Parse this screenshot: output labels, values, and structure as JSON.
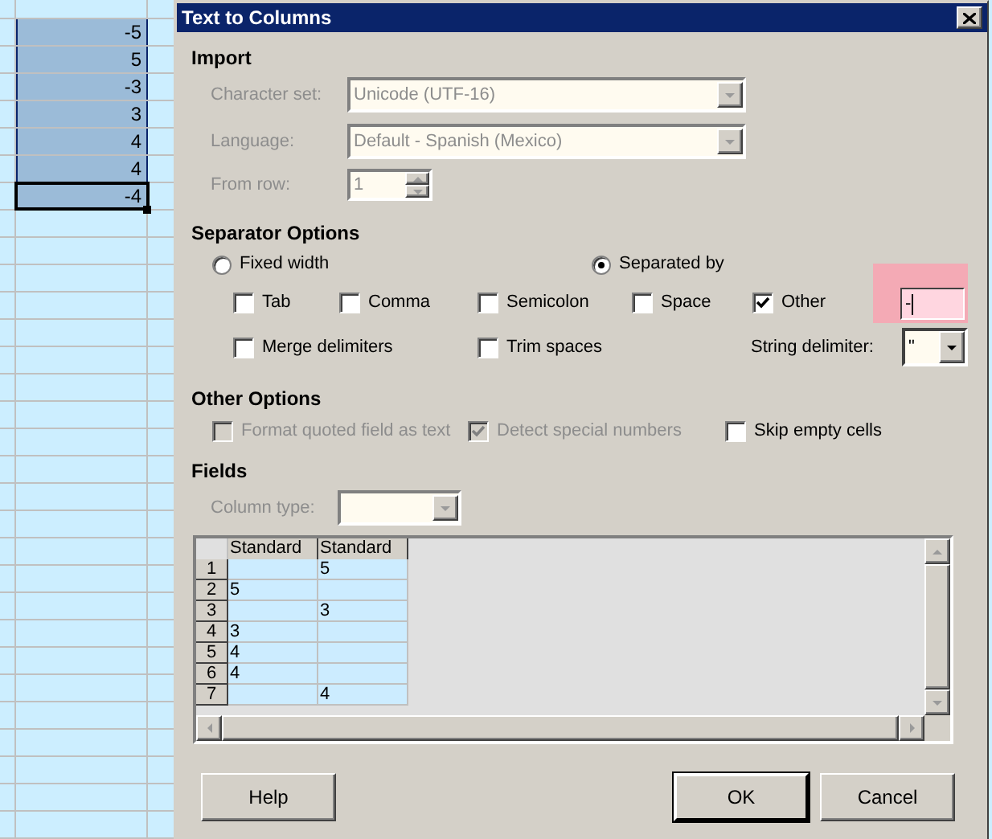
{
  "spreadsheet": {
    "cells": [
      {
        "value": "-5",
        "selected": true,
        "active": false
      },
      {
        "value": "5",
        "selected": true,
        "active": false
      },
      {
        "value": "-3",
        "selected": true,
        "active": false
      },
      {
        "value": "3",
        "selected": true,
        "active": false
      },
      {
        "value": "4",
        "selected": true,
        "active": false
      },
      {
        "value": "4",
        "selected": true,
        "active": false
      },
      {
        "value": "-4",
        "selected": true,
        "active": true
      }
    ]
  },
  "dialog": {
    "title": "Text to Columns",
    "import": {
      "heading": "Import",
      "fields": [
        {
          "label": "Character set:",
          "value": "Unicode (UTF-16)",
          "kind": "combo",
          "disabled": true
        },
        {
          "label": "Language:",
          "value": "Default - Spanish (Mexico)",
          "kind": "combo",
          "disabled": true
        },
        {
          "label": "From row:",
          "value": "1",
          "kind": "spin",
          "disabled": true
        }
      ]
    },
    "separator_options": {
      "heading": "Separator Options",
      "modes": [
        {
          "label": "Fixed width",
          "selected": false
        },
        {
          "label": "Separated by",
          "selected": true
        }
      ],
      "separators": [
        {
          "label": "Tab",
          "checked": false
        },
        {
          "label": "Comma",
          "checked": false
        },
        {
          "label": "Semicolon",
          "checked": false
        },
        {
          "label": "Space",
          "checked": false
        },
        {
          "label": "Other",
          "checked": true
        }
      ],
      "other_field": {
        "value": "-",
        "highlighted": true
      },
      "merge_delimiters": {
        "label": "Merge delimiters",
        "checked": false
      },
      "trim_spaces": {
        "label": "Trim spaces",
        "checked": false
      },
      "string_delimiter": {
        "label": "String delimiter:",
        "value": "\""
      }
    },
    "other_options": {
      "heading": "Other Options",
      "options": [
        {
          "label": "Format quoted field as text",
          "checked": false,
          "disabled": true
        },
        {
          "label": "Detect special numbers",
          "checked": true,
          "disabled": true
        },
        {
          "label": "Skip empty cells",
          "checked": false,
          "disabled": false
        }
      ]
    },
    "fields": {
      "heading": "Fields",
      "column_type": {
        "label": "Column type:",
        "disabled": true
      },
      "preview": {
        "columns": [
          "Standard",
          "Standard"
        ],
        "rows": [
          {
            "number": "1",
            "cells": [
              null,
              "5"
            ]
          },
          {
            "number": "2",
            "cells": [
              "5",
              null
            ]
          },
          {
            "number": "3",
            "cells": [
              null,
              "3"
            ]
          },
          {
            "number": "4",
            "cells": [
              "3",
              null
            ]
          },
          {
            "number": "5",
            "cells": [
              "4",
              null
            ]
          },
          {
            "number": "6",
            "cells": [
              "4",
              null
            ]
          },
          {
            "number": "7",
            "cells": [
              null,
              "4"
            ]
          }
        ]
      }
    },
    "buttons": [
      {
        "label": "Help",
        "default": false
      },
      {
        "label": "OK",
        "default": true
      },
      {
        "label": "Cancel",
        "default": false
      }
    ]
  }
}
